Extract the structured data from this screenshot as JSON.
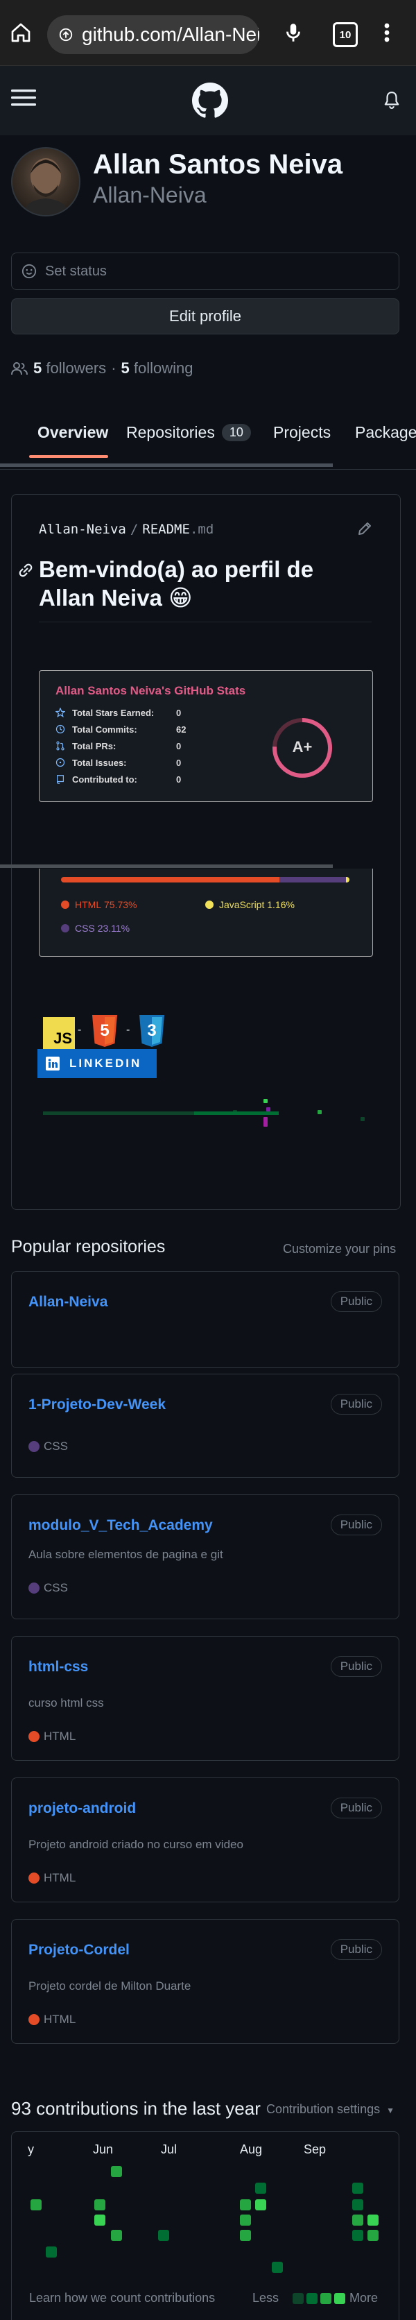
{
  "browser": {
    "url": "github.com/Allan-Nei",
    "tab_count": "10"
  },
  "profile": {
    "full_name": "Allan Santos Neiva",
    "username": "Allan-Neiva",
    "status_placeholder": "Set status",
    "edit_profile": "Edit profile",
    "followers_count": "5",
    "followers_label": "followers",
    "separator": "·",
    "following_count": "5",
    "following_label": "following"
  },
  "tabs": [
    {
      "label": "Overview",
      "active": true
    },
    {
      "label": "Repositories",
      "count": "10"
    },
    {
      "label": "Projects"
    },
    {
      "label": "Packages"
    }
  ],
  "readme": {
    "path_user": "Allan-Neiva",
    "path_sep": "/",
    "path_file": "README",
    "path_ext": ".md",
    "heading": "Bem-vindo(a) ao perfil de Allan Neiva 😁",
    "stats": {
      "title": "Allan Santos Neiva's GitHub Stats",
      "rows": [
        {
          "label": "Total Stars Earned:",
          "value": "0",
          "icon": "star-icon"
        },
        {
          "label": "Total Commits:",
          "value": "62",
          "icon": "history-icon"
        },
        {
          "label": "Total PRs:",
          "value": "0",
          "icon": "pull-request-icon"
        },
        {
          "label": "Total Issues:",
          "value": "0",
          "icon": "issue-icon"
        },
        {
          "label": "Contributed to:",
          "value": "0",
          "icon": "repo-icon"
        }
      ],
      "grade": "A+",
      "title_color": "#e15b87"
    },
    "languages": [
      {
        "name": "HTML",
        "percent": "75.73%",
        "value": 75.73,
        "color": "#e34c26"
      },
      {
        "name": "JavaScript",
        "percent": "1.16%",
        "value": 1.16,
        "color": "#f1e05a"
      },
      {
        "name": "CSS",
        "percent": "23.11%",
        "value": 23.11,
        "color": "#563d7c"
      }
    ],
    "badges": {
      "js": "JS",
      "html": "5",
      "css": "3",
      "separator": "-",
      "linkedin": "LINKEDIN"
    }
  },
  "popular": {
    "title": "Popular repositories",
    "customize": "Customize your pins",
    "repos": [
      {
        "name": "Allan-Neiva",
        "visibility": "Public"
      },
      {
        "name": "1-Projeto-Dev-Week",
        "visibility": "Public",
        "language": "CSS",
        "lang_color": "#563d7c"
      },
      {
        "name": "modulo_V_Tech_Academy",
        "visibility": "Public",
        "description": "Aula sobre elementos de pagina e git",
        "language": "CSS",
        "lang_color": "#563d7c"
      },
      {
        "name": "html-css",
        "visibility": "Public",
        "description": "curso html css",
        "language": "HTML",
        "lang_color": "#e34c26"
      },
      {
        "name": "projeto-android",
        "visibility": "Public",
        "description": "Projeto android criado no curso em video",
        "language": "HTML",
        "lang_color": "#e34c26"
      },
      {
        "name": "Projeto-Cordel",
        "visibility": "Public",
        "description": "Projeto cordel de Milton Duarte",
        "language": "HTML",
        "lang_color": "#e34c26"
      }
    ]
  },
  "contributions": {
    "title": "93 contributions in the last year",
    "settings": "Contribution settings",
    "months": [
      "y",
      "Jun",
      "Jul",
      "Aug",
      "Sep"
    ],
    "learn_link": "Learn how we count contributions",
    "less": "Less",
    "more": "More",
    "level_colors": [
      "#0e4429",
      "#006d32",
      "#26a641",
      "#39d353"
    ]
  }
}
